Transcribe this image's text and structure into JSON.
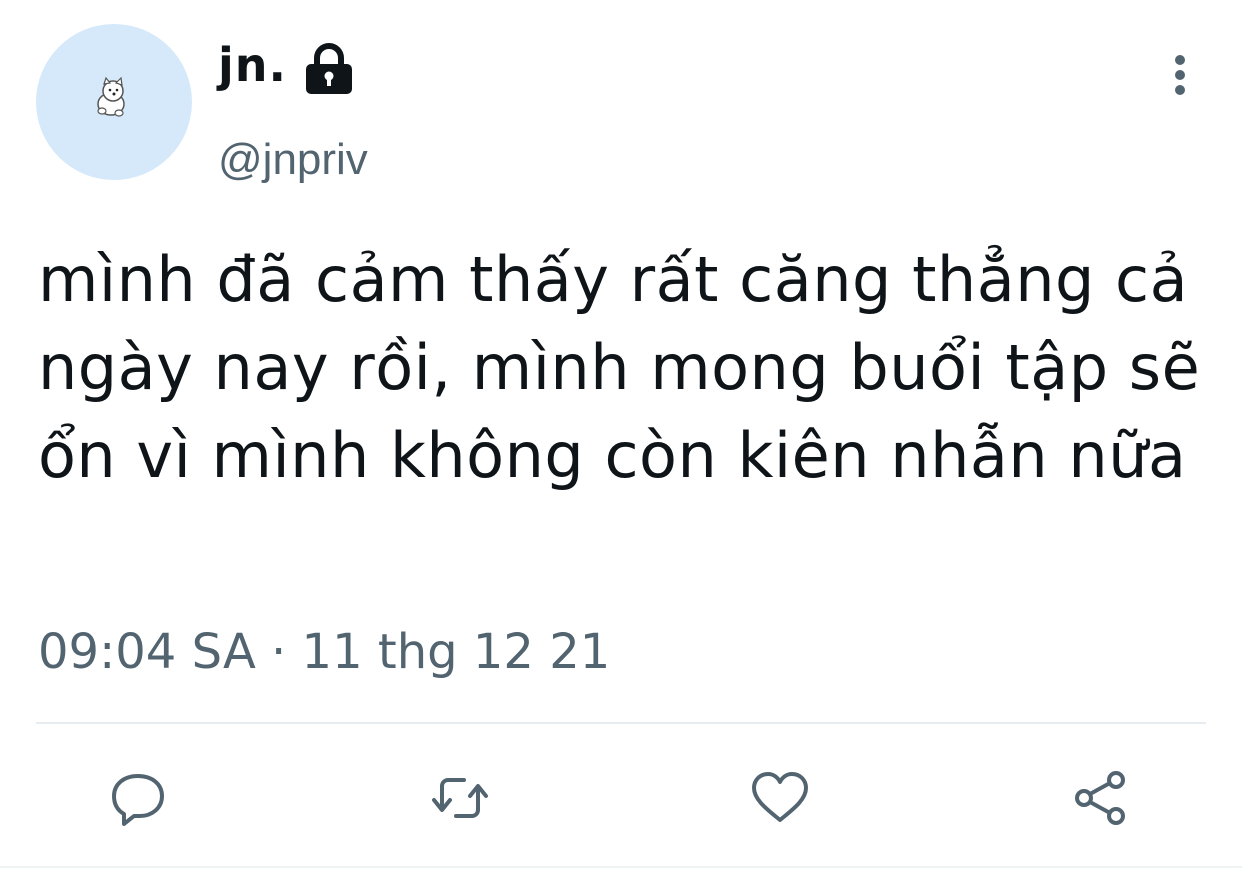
{
  "tweet": {
    "display_name": "jn.",
    "handle": "@jnpriv",
    "text": "mình đã cảm thấy rất căng thẳng cả ngày nay rồi, mình mong buổi tập sẽ ổn vì mình không còn kiên nhẫn nữa",
    "timestamp": "09:04 SA · 11 thg 12 21",
    "avatar_icon": "white-dog-icon",
    "protected_icon": "lock-icon"
  },
  "actions": [
    {
      "name": "reply",
      "icon": "speech-bubble-icon"
    },
    {
      "name": "retweet",
      "icon": "retweet-arrows-icon"
    },
    {
      "name": "like",
      "icon": "heart-icon"
    },
    {
      "name": "share",
      "icon": "share-icon"
    }
  ],
  "colors": {
    "text": "#0f1419",
    "secondary": "#536471",
    "avatar_bg": "#d6e9fb",
    "divider": "#e6ecf0"
  }
}
